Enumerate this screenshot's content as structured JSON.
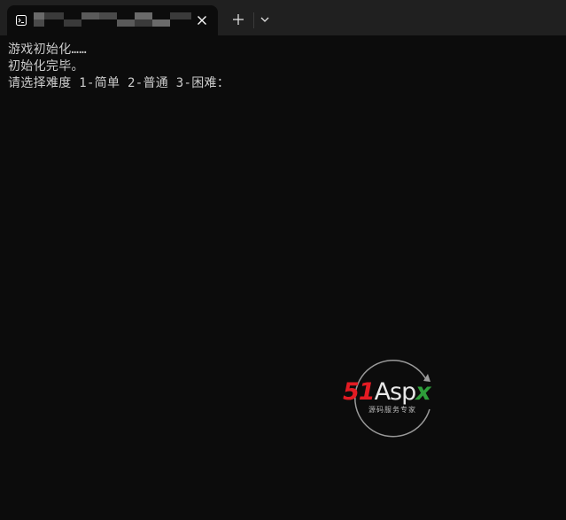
{
  "window": {
    "title": "",
    "tab_icon": "terminal-icon",
    "new_tab_icon": "plus-icon",
    "dropdown_icon": "chevron-down-icon",
    "close_icon": "close-icon"
  },
  "terminal": {
    "lines": [
      "游戏初始化……",
      "初始化完毕。",
      "请选择难度 1-简单 2-普通 3-困难："
    ]
  },
  "watermark": {
    "brand_number": "51",
    "brand_name": "Asp",
    "brand_suffix": "x",
    "tagline": "源码服务专家"
  },
  "colors": {
    "background": "#0c0c0c",
    "titlebar": "#202020",
    "text": "#cccccc",
    "brand_red": "#e31b23",
    "brand_green": "#2e9e3a"
  }
}
